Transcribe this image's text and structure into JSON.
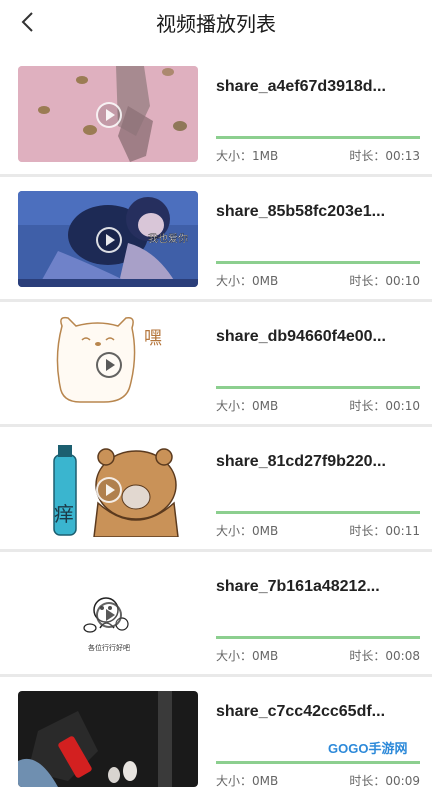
{
  "header": {
    "title": "视频播放列表",
    "back_icon": "chevron-left-icon"
  },
  "labels": {
    "size_prefix": "大小：",
    "duration_prefix": "时长："
  },
  "items": [
    {
      "name": "share_a4ef67d3918d...",
      "size": "大小：1MB",
      "duration": "时长：00:13",
      "progress": 1.0
    },
    {
      "name": "share_85b58fc203e1...",
      "size": "大小：0MB",
      "duration": "时长：00:10",
      "progress": 1.0,
      "thumb_text": "我也爱你"
    },
    {
      "name": "share_db94660f4e00...",
      "size": "大小：0MB",
      "duration": "时长：00:10",
      "progress": 1.0,
      "thumb_text": "嘿"
    },
    {
      "name": "share_81cd27f9b220...",
      "size": "大小：0MB",
      "duration": "时长：00:11",
      "progress": 1.0,
      "thumb_text": "痒"
    },
    {
      "name": "share_7b161a48212...",
      "size": "大小：0MB",
      "duration": "时长：00:08",
      "progress": 1.0,
      "thumb_text": "各位行行好吧"
    },
    {
      "name": "share_c7cc42cc65df...",
      "size": "大小：0MB",
      "duration": "时长：00:09",
      "progress": 1.0
    }
  ],
  "watermark": "GOGO手游网",
  "colors": {
    "progress": "#8ccf8f",
    "divider": "#e9e9e9"
  }
}
